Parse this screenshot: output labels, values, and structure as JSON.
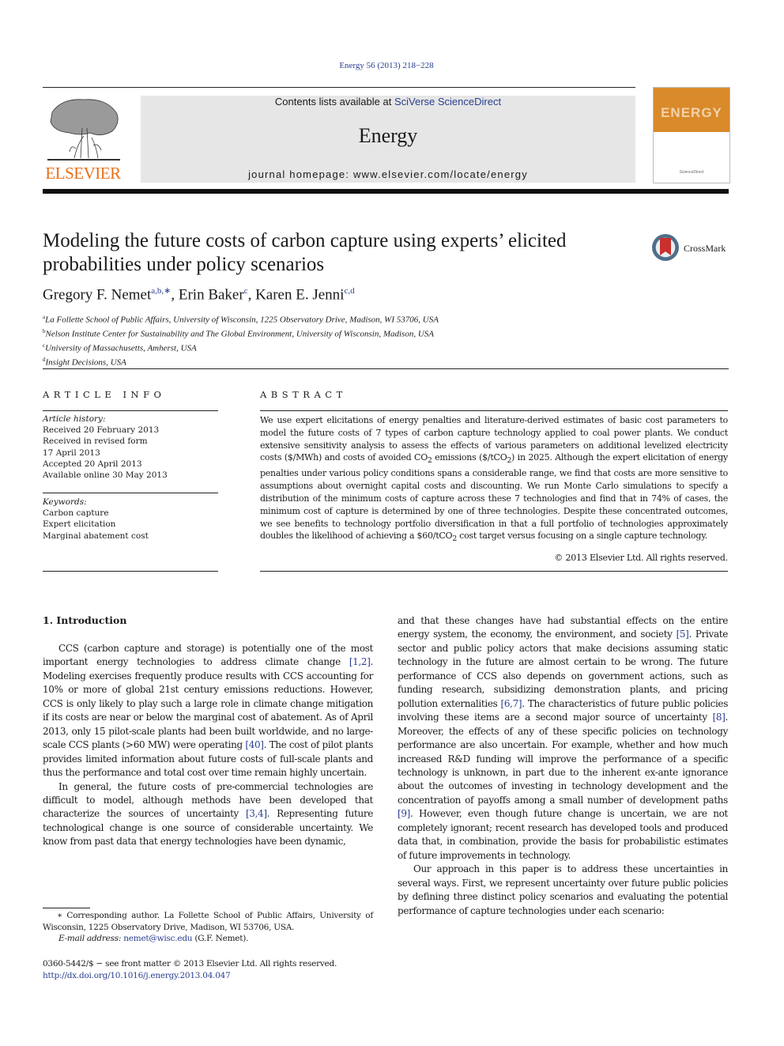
{
  "header": {
    "citation": "Energy 56 (2013) 218−228",
    "contents_prefix": "Contents lists available at ",
    "sciencedirect_link": "SciVerse ScienceDirect",
    "journal_name": "Energy",
    "homepage": "journal homepage: www.elsevier.com/locate/energy",
    "publisher_logo": "ELSEVIER",
    "cover_title": "ENERGY",
    "cover_publisher": "ScienceDirect"
  },
  "crossmark": {
    "label": "CrossMark"
  },
  "article": {
    "title": "Modeling the future costs of carbon capture using experts’ elicited probabilities under policy scenarios",
    "authors": [
      {
        "name": "Gregory F. Nemet",
        "sup": "a,b,∗"
      },
      {
        "name": "Erin Baker",
        "sup": "c"
      },
      {
        "name": "Karen E. Jenni",
        "sup": "c,d"
      }
    ],
    "affiliations": [
      {
        "key": "a",
        "text": "La Follette School of Public Affairs, University of Wisconsin, 1225 Observatory Drive, Madison, WI 53706, USA"
      },
      {
        "key": "b",
        "text": "Nelson Institute Center for Sustainability and The Global Environment, University of Wisconsin, Madison, USA"
      },
      {
        "key": "c",
        "text": "University of Massachusetts, Amherst, USA"
      },
      {
        "key": "d",
        "text": "Insight Decisions, USA"
      }
    ]
  },
  "article_info": {
    "heading": "ARTICLE INFO",
    "history_label": "Article history:",
    "history": [
      "Received 20 February 2013",
      "Received in revised form",
      "17 April 2013",
      "Accepted 20 April 2013",
      "Available online 30 May 2013"
    ],
    "keywords_label": "Keywords:",
    "keywords": [
      "Carbon capture",
      "Expert elicitation",
      "Marginal abatement cost"
    ]
  },
  "abstract": {
    "heading": "ABSTRACT",
    "part1": "We use expert elicitations of energy penalties and literature-derived estimates of basic cost parameters to model the future costs of 7 types of carbon capture technology applied to coal power plants. We conduct extensive sensitivity analysis to assess the effects of various parameters on additional levelized electricity costs ($/MWh) and costs of avoided CO",
    "part2": " emissions ($/tCO",
    "part3": ") in 2025. Although the expert elicitation of energy penalties under various policy conditions spans a considerable range, we find that costs are more sensitive to assumptions about overnight capital costs and discounting. We run Monte Carlo simulations to specify a distribution of the minimum costs of capture across these 7 technologies and find that in 74% of cases, the minimum cost of capture is determined by one of three technologies. Despite these concentrated outcomes, we see benefits to technology portfolio diversification in that a full portfolio of technologies approximately doubles the likelihood of achieving a $60/tCO",
    "part4": " cost target versus focusing on a single capture technology.",
    "subscript": "2",
    "copyright": "© 2013 Elsevier Ltd. All rights reserved."
  },
  "intro": {
    "heading": "1.  Introduction",
    "left_p1_a": "CCS (carbon capture and storage) is potentially one of the most important energy technologies to address climate change ",
    "ref_1_2": "[1,2]",
    "left_p1_b": ". Modeling exercises frequently produce results with CCS accounting for 10% or more of global 21st century emissions reductions. However, CCS is only likely to play such a large role in climate change mitigation if its costs are near or below the marginal cost of abatement. As of April 2013, only 15 pilot-scale plants had been built worldwide, and no large-scale CCS plants (>60 MW) were operating ",
    "ref_40": "[40]",
    "left_p1_c": ". The cost of pilot plants provides limited information about future costs of full-scale plants and thus the performance and total cost over time remain highly uncertain.",
    "left_p2_a": "In general, the future costs of pre-commercial technologies are difficult to model, although methods have been developed that characterize the sources of uncertainty ",
    "ref_3_4": "[3,4]",
    "left_p2_b": ". Representing future technological change is one source of considerable uncertainty. We know from past data that energy technologies have been dynamic,",
    "right_p1_a": "and that these changes have had substantial effects on the entire energy system, the economy, the environment, and society ",
    "ref_5": "[5]",
    "right_p1_b": ". Private sector and public policy actors that make decisions assuming static technology in the future are almost certain to be wrong. The future performance of CCS also depends on government actions, such as funding research, subsidizing demonstration plants, and pricing pollution externalities ",
    "ref_6_7": "[6,7]",
    "right_p1_c": ". The characteristics of future public policies involving these items are a second major source of uncertainty ",
    "ref_8": "[8]",
    "right_p1_d": ". Moreover, the effects of any of these specific policies on technology performance are also uncertain. For example, whether and how much increased R&D funding will improve the performance of a specific technology is unknown, in part due to the inherent ex-ante ignorance about the outcomes of investing in technology development and the concentration of payoffs among a small number of development paths ",
    "ref_9": "[9]",
    "right_p1_e": ". However, even though future change is uncertain, we are not completely ignorant; recent research has developed tools and produced data that, in combination, provide the basis for probabilistic estimates of future improvements in technology.",
    "right_p2": "Our approach in this paper is to address these uncertainties in several ways. First, we represent uncertainty over future public policies by defining three distinct policy scenarios and evaluating the potential performance of capture technologies under each scenario:"
  },
  "footnote": {
    "corresponding": "∗ Corresponding author. La Follette School of Public Affairs, University of Wisconsin, 1225 Observatory Drive, Madison, WI 53706, USA.",
    "email_label": "E-mail address:",
    "email": "nemet@wisc.edu",
    "email_suffix": " (G.F. Nemet).",
    "issn": "0360-5442/$ − see front matter © 2013 Elsevier Ltd. All rights reserved.",
    "doi": "http://dx.doi.org/10.1016/j.energy.2013.04.047"
  }
}
